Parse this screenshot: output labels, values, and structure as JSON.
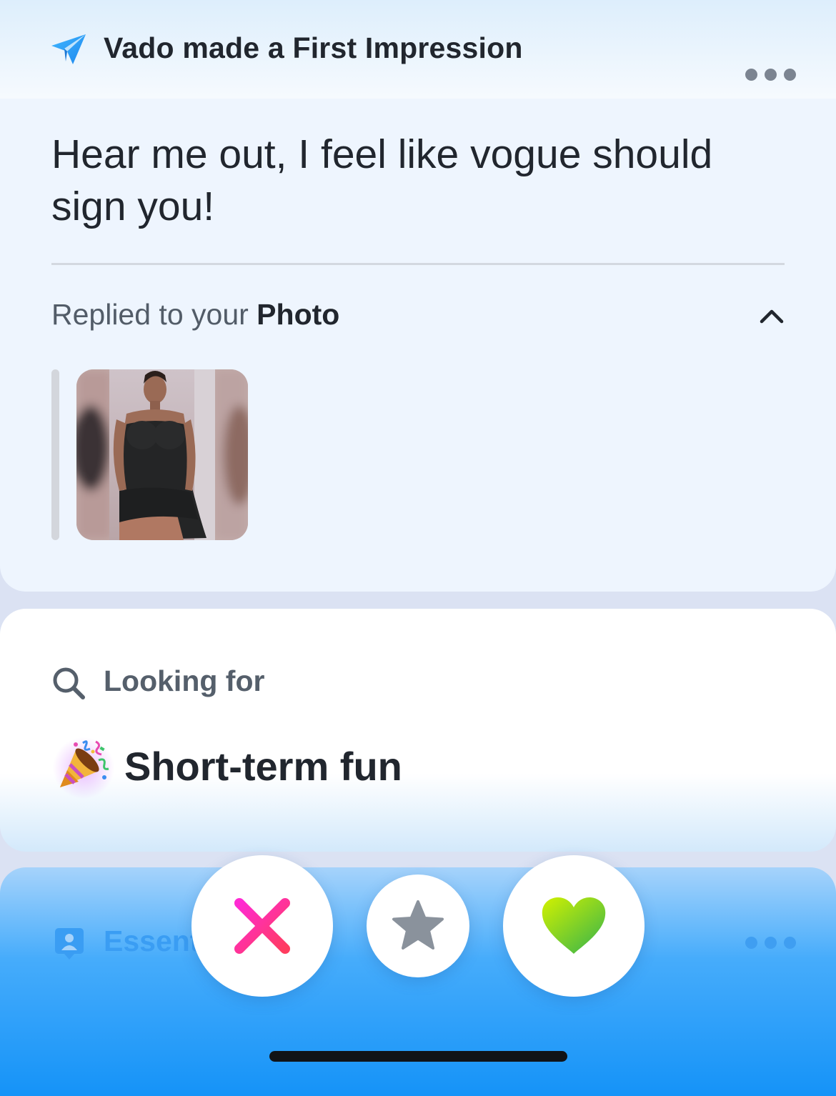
{
  "header": {
    "title": "Vado made a First Impression"
  },
  "message": {
    "text": "Hear me out, I feel like vogue should sign you!"
  },
  "reply": {
    "prefix": "Replied to your ",
    "target": "Photo"
  },
  "looking_for": {
    "label": "Looking for",
    "value": "Short-term fun",
    "emoji": "party-popper"
  },
  "essentials": {
    "label_visible": "Essent"
  },
  "actions": {
    "nope": "nope-button",
    "super_like": "super-like-button",
    "like": "like-button"
  },
  "colors": {
    "accent_blue": "#1593f8",
    "nope_start": "#ff2ad3",
    "nope_end": "#ff3c5f",
    "like_start": "#d2f100",
    "like_end": "#3ab54a",
    "star": "#8a929c"
  }
}
